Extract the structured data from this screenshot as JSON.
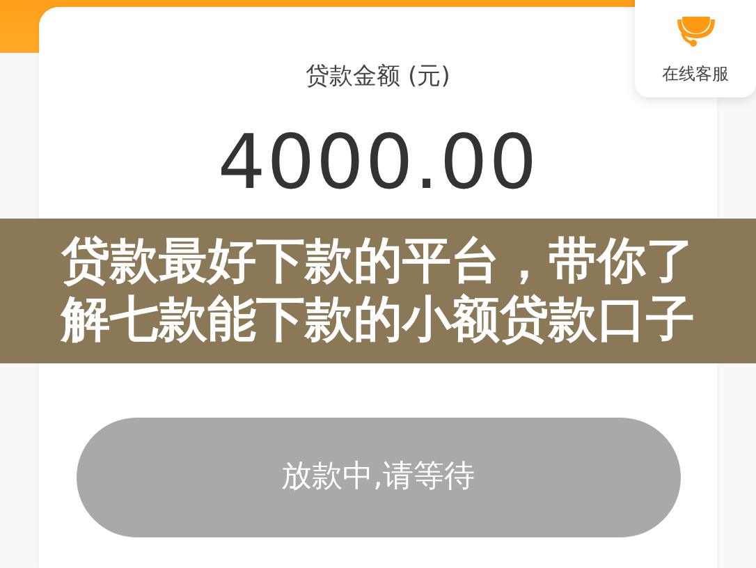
{
  "service_widget": {
    "label": "在线客服"
  },
  "loan_card": {
    "label": "贷款金额 (元)",
    "amount": "4000.00"
  },
  "banner": {
    "lines": [
      "贷款最好下款的平台，带你了",
      "解七款能下款的小额贷款口子"
    ]
  },
  "action_button": {
    "label": "放款中,请等待",
    "disabled": true
  }
}
